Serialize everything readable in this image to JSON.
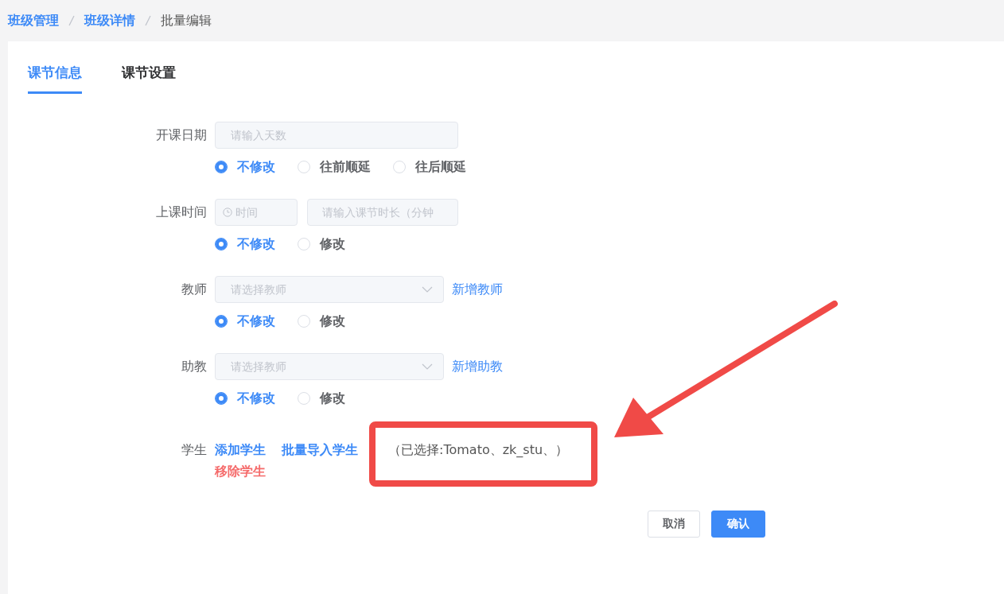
{
  "breadcrumb": [
    {
      "label": "班级管理",
      "kind": "link"
    },
    {
      "label": "班级详情",
      "kind": "link"
    },
    {
      "label": "批量编辑",
      "kind": "current"
    }
  ],
  "tabs": [
    {
      "label": "课节信息",
      "selected": true
    },
    {
      "label": "课节设置",
      "selected": false
    }
  ],
  "fields": [
    {
      "kind": "input",
      "label": "开课日期",
      "inputs": [
        {
          "kind": "text",
          "placeholder": "请输入天数"
        }
      ],
      "options": [
        {
          "label": "不修改",
          "selected": true
        },
        {
          "label": "往前顺延",
          "selected": false
        },
        {
          "label": "往后顺延",
          "selected": false
        }
      ]
    },
    {
      "kind": "input",
      "label": "上课时间",
      "inputs": [
        {
          "kind": "time",
          "placeholder": "时间"
        },
        {
          "kind": "text",
          "placeholder": "请输入课节时长（分钟"
        }
      ],
      "options": [
        {
          "label": "不修改",
          "selected": true
        },
        {
          "label": "修改",
          "selected": false
        }
      ]
    },
    {
      "kind": "select",
      "label": "教师",
      "placeholder": "请选择教师",
      "link": "新增教师",
      "options": [
        {
          "label": "不修改",
          "selected": true
        },
        {
          "label": "修改",
          "selected": false
        }
      ]
    },
    {
      "kind": "select",
      "label": "助教",
      "placeholder": "请选择教师",
      "link": "新增助教",
      "options": [
        {
          "label": "不修改",
          "selected": true
        },
        {
          "label": "修改",
          "selected": false
        }
      ]
    },
    {
      "kind": "students",
      "label": "学生",
      "actions": [
        {
          "label": "添加学生",
          "kind": "add"
        },
        {
          "label": "批量导入学生",
          "kind": "add"
        },
        {
          "label": "移除学生",
          "kind": "remove"
        }
      ],
      "selection": "（已选择:Tomato、zk_stu、）"
    }
  ],
  "buttons": [
    {
      "label": "取消",
      "kind": "default"
    },
    {
      "label": "确认",
      "kind": "primary"
    }
  ]
}
